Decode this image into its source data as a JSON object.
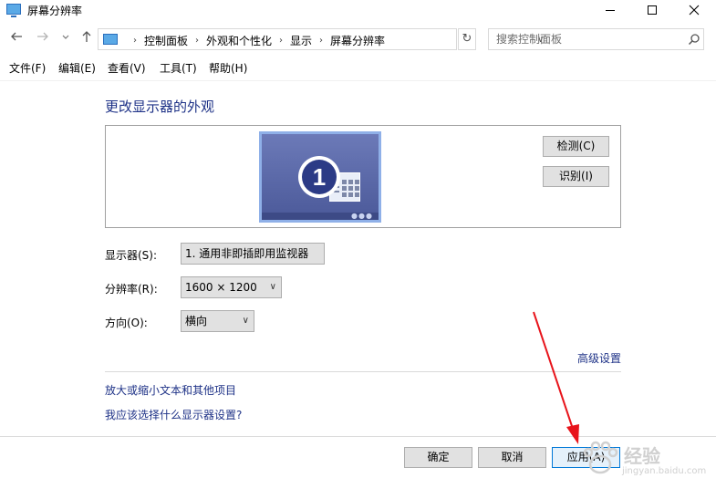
{
  "window": {
    "title": "屏幕分辨率"
  },
  "address": {
    "crumbs": [
      "控制面板",
      "外观和个性化",
      "显示",
      "屏幕分辨率"
    ]
  },
  "search": {
    "placeholder": "搜索控制面板"
  },
  "menu": {
    "items": [
      "文件(F)",
      "编辑(E)",
      "查看(V)",
      "工具(T)",
      "帮助(H)"
    ]
  },
  "main": {
    "heading": "更改显示器的外观",
    "monitor_number": "1",
    "detect_label": "检测(C)",
    "identify_label": "识别(I)",
    "display_label": "显示器(S):",
    "display_value": "1. 通用非即插即用监视器",
    "resolution_label": "分辨率(R):",
    "resolution_value": "1600 × 1200",
    "orientation_label": "方向(O):",
    "orientation_value": "横向",
    "advanced_link": "高级设置",
    "link_text_size": "放大或缩小文本和其他项目",
    "link_which_settings": "我应该选择什么显示器设置?"
  },
  "footer": {
    "ok_label": "确定",
    "cancel_label": "取消",
    "apply_label": "应用(A)"
  },
  "watermark": {
    "text": "经验",
    "sub": "jingyan.baidu.com"
  },
  "colors": {
    "link": "#1e3287",
    "annotation_arrow": "#e8141b",
    "monitor_fill": "#5b6aa8",
    "primary_button_border": "#0078d7"
  }
}
